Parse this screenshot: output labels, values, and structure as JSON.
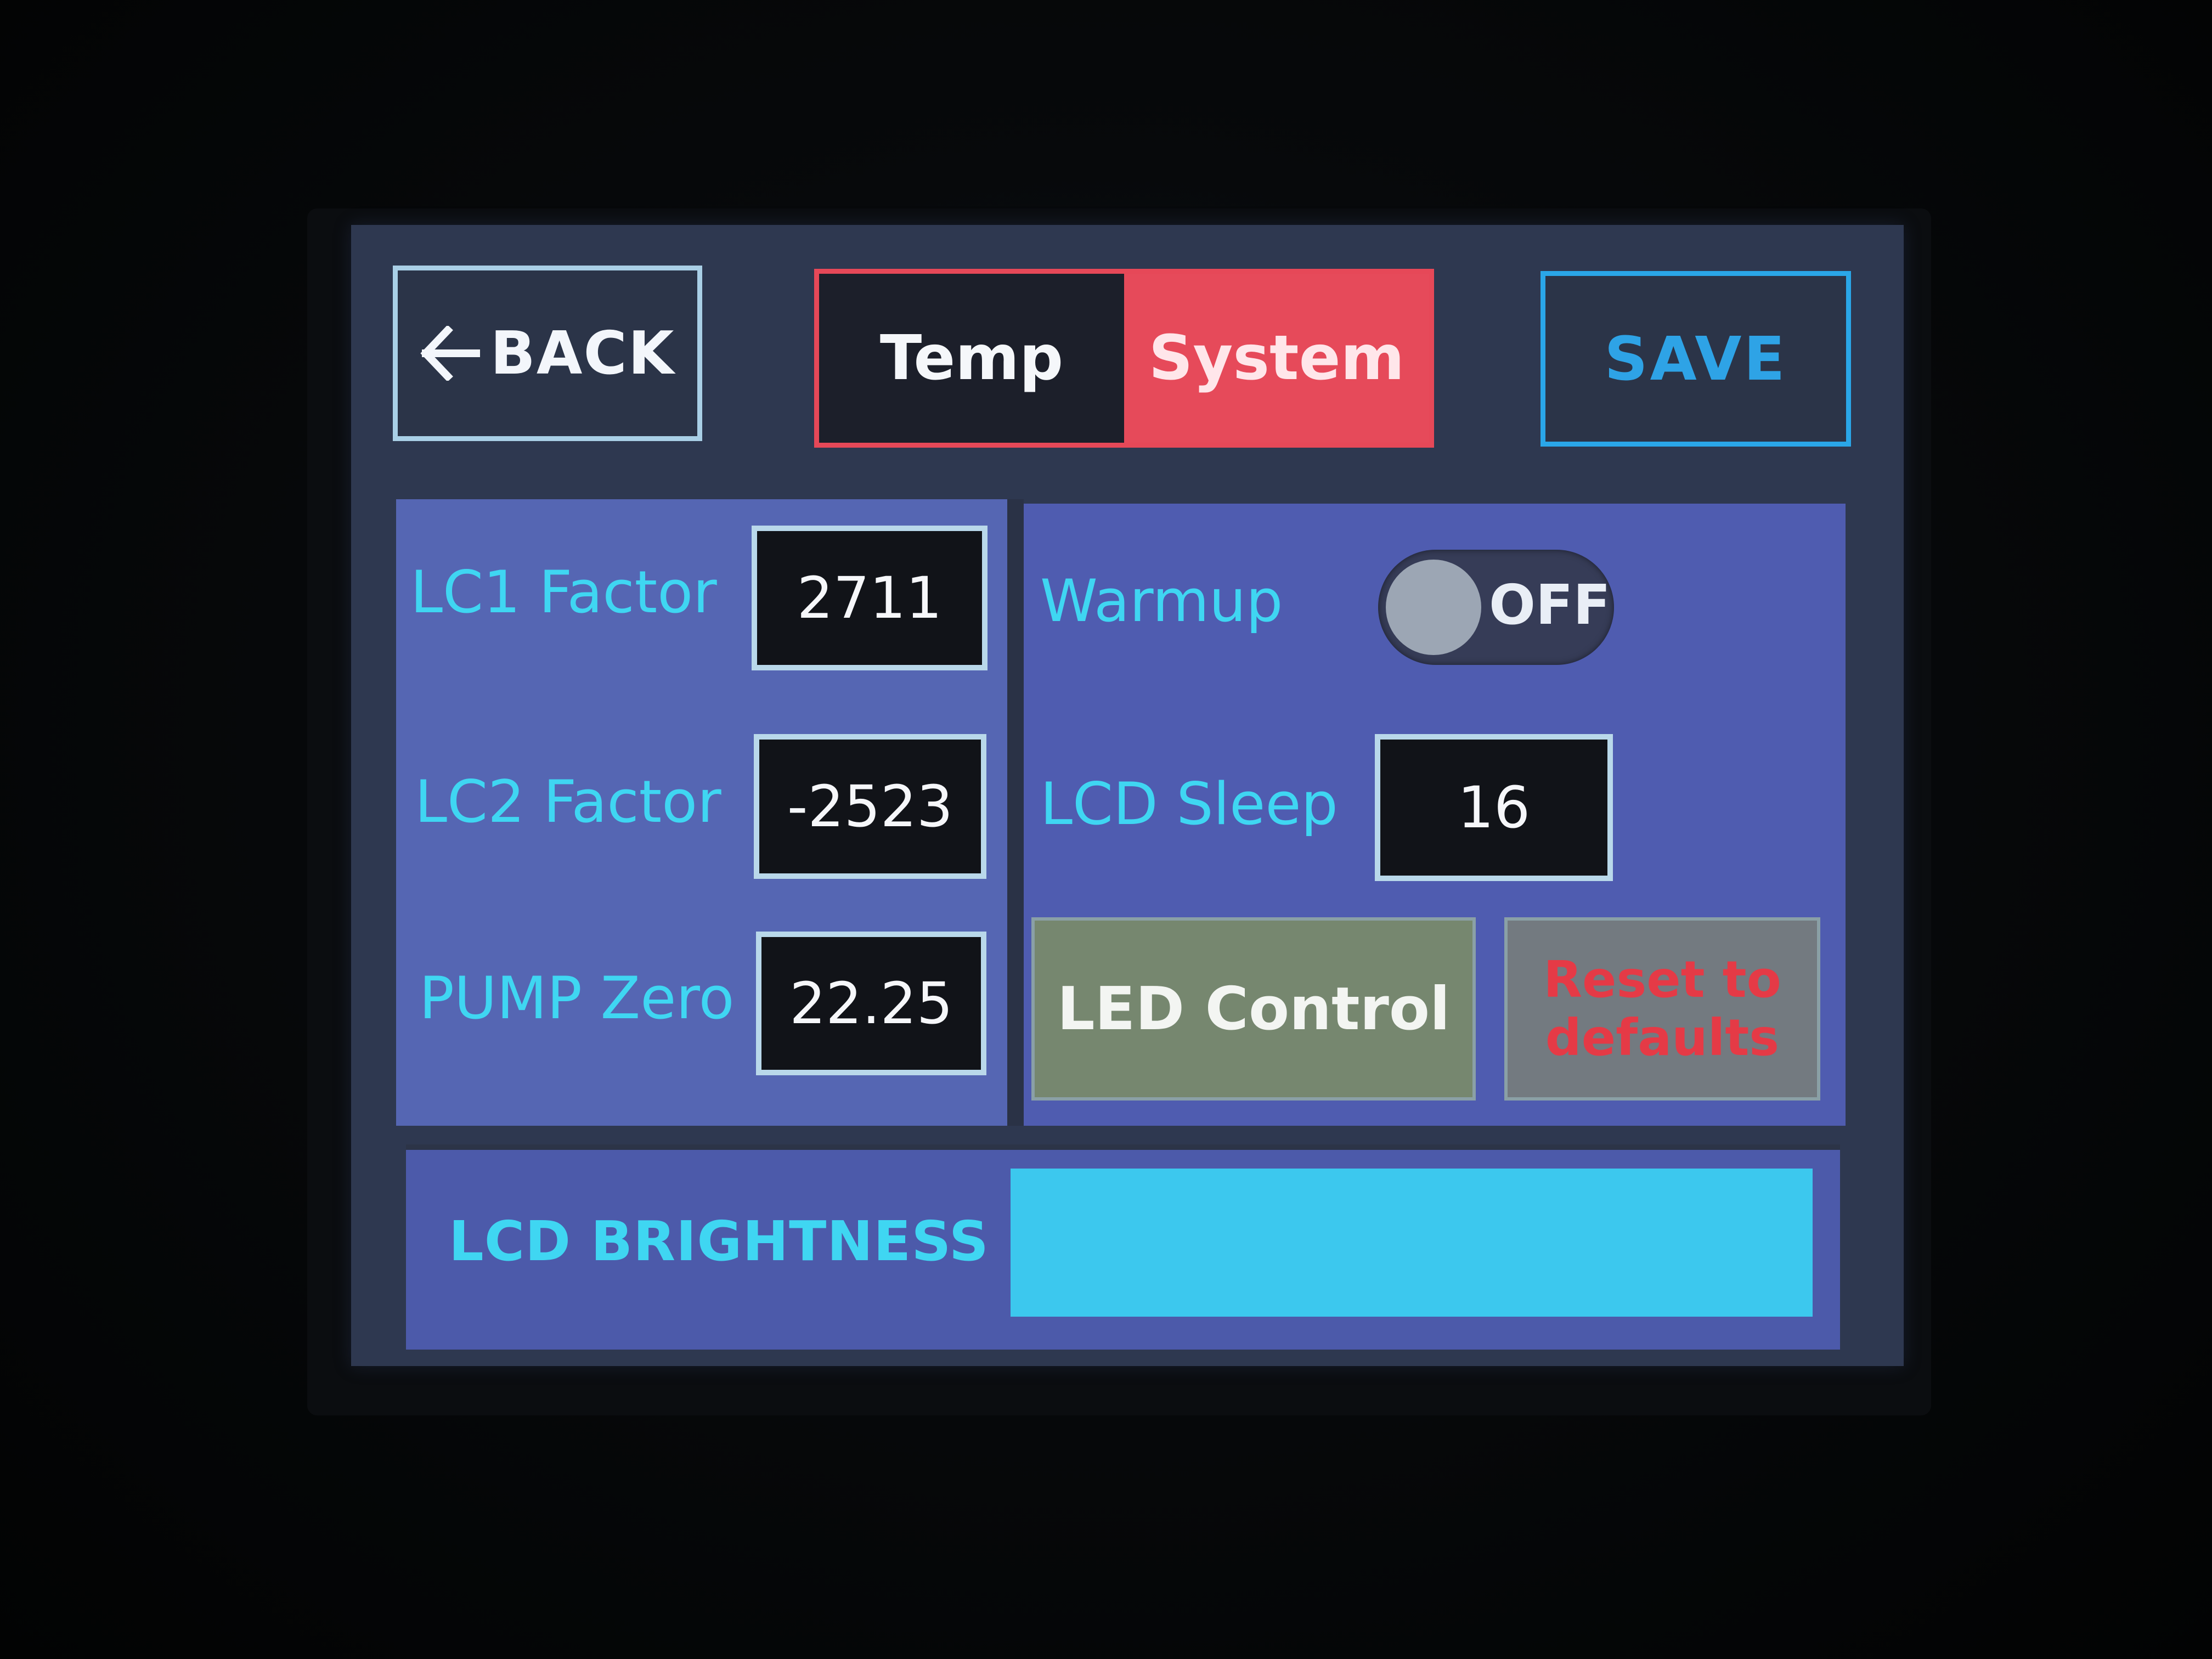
{
  "header": {
    "back_label": "BACK",
    "tabs": [
      {
        "label": "Temp",
        "active": false
      },
      {
        "label": "System",
        "active": true
      }
    ],
    "save_label": "SAVE"
  },
  "left_panel": {
    "lc1": {
      "label": "LC1 Factor",
      "value": "2711"
    },
    "lc2": {
      "label": "LC2 Factor",
      "value": "-2523"
    },
    "pump": {
      "label": "PUMP Zero",
      "value": "22.25"
    }
  },
  "right_panel": {
    "warmup": {
      "label": "Warmup",
      "state": "OFF"
    },
    "lcd_sleep": {
      "label": "LCD Sleep",
      "value": "16"
    },
    "led_control_label": "LED Control",
    "reset_line1": "Reset to",
    "reset_line2": "defaults"
  },
  "bottom_panel": {
    "brightness_label": "LCD BRIGHTNESS",
    "brightness_level": 1.0
  },
  "colors": {
    "accent_red": "#e64a5a",
    "accent_blue": "#2ea3e6",
    "label_cyan": "#3fd6f2",
    "panel_blue": "#5566b3"
  }
}
